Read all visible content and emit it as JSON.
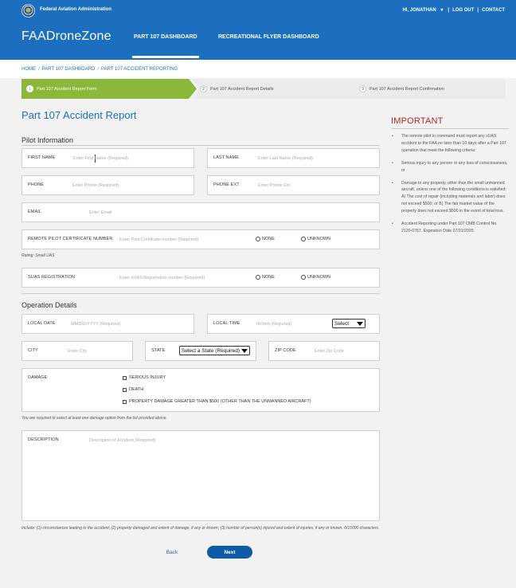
{
  "header": {
    "agency": "Federal Aviation Administration",
    "user_greeting": "HI, JONATHAN",
    "logout": "LOG OUT",
    "contact": "CONTACT",
    "brand": "FAADroneZone",
    "nav": [
      {
        "label": "PART 107 DASHBOARD",
        "active": true
      },
      {
        "label": "RECREATIONAL FLYER DASHBOARD",
        "active": false
      }
    ]
  },
  "breadcrumb": [
    "HOME",
    "PART 107 DASHBOARD",
    "PART 107 ACCIDENT REPORTING"
  ],
  "steps": [
    {
      "num": "1",
      "label": "Part 107 Accident Report Form",
      "active": true
    },
    {
      "num": "2",
      "label": "Part 107 Accident Report Details",
      "active": false
    },
    {
      "num": "3",
      "label": "Part 107 Accident Report Confirmation",
      "active": false
    }
  ],
  "form": {
    "title": "Part 107 Accident Report",
    "pilot_section": "Pilot Information",
    "first_name": {
      "label": "FIRST NAME",
      "placeholder": "Enter First Name (Required)",
      "value": ""
    },
    "last_name": {
      "label": "LAST NAME",
      "placeholder": "Enter Last Name (Required)",
      "value": ""
    },
    "phone": {
      "label": "PHONE",
      "placeholder": "Enter Phone (Required)",
      "value": ""
    },
    "phone_ext": {
      "label": "PHONE EXT",
      "placeholder": "Enter Phone Ext",
      "value": ""
    },
    "email": {
      "label": "EMAIL",
      "placeholder": "Enter Email",
      "value": ""
    },
    "cert": {
      "label": "REMOTE PILOT CERTIFICATE NUMBER",
      "placeholder": "Enter Pilot Certificate number (Required)",
      "value": "",
      "opt_none": "NONE",
      "opt_unknown": "UNKNOWN"
    },
    "rating": "Rating: Small UAS",
    "suas": {
      "label": "SUAS REGISTRATION",
      "placeholder": "Enter sUAS Registration number (Required)",
      "value": "",
      "opt_none": "NONE",
      "opt_unknown": "UNKNOWN"
    },
    "operation_section": "Operation Details",
    "local_date": {
      "label": "LOCAL DATE",
      "placeholder": "MM/DD/YYYY (Required)",
      "value": ""
    },
    "local_time": {
      "label": "LOCAL TIME",
      "placeholder": "hh:mm (Required)",
      "value": "",
      "select": "Select"
    },
    "city": {
      "label": "CITY",
      "placeholder": "Enter City",
      "value": ""
    },
    "state": {
      "label": "STATE",
      "select": "Select a State (Required)"
    },
    "zip": {
      "label": "ZIP CODE",
      "placeholder": "Enter Zip Code",
      "value": ""
    },
    "damage": {
      "label": "DAMAGE",
      "options": [
        "SERIOUS INJURY",
        "DEATH",
        "PROPERTY DAMAGE GREATER THAN $500 (OTHER THAN THE UNMANNED AIRCRAFT)"
      ]
    },
    "damage_note": "You are required to select at least one damage option from the list provided above.",
    "description": {
      "label": "DESCRIPTION",
      "placeholder": "Description of Accident (Required)",
      "value": ""
    },
    "description_note": "Include: (1) circumstances leading to the accident; (2) property damaged and extent of damage, if any or known; (3) number of person(s) injured and extent of injuries, if any or known. 0/15000 characters.",
    "back": "Back",
    "next": "Next"
  },
  "important": {
    "title": "IMPORTANT",
    "items": [
      "The remote pilot in command must report any sUAS accident to the FAA no later than 10 days after a Part 107 operation that meet the following criteria:",
      "Serious injury to any person or any loss of consciousness, or",
      "Damage to any property, other than the small unmanned aircraft, unless one of the following conditions is satisfied: A) The cost of repair (including materials and labor) does not exceed $500; or B) The fair market value of the property does not exceed $500 in the event of total loss.",
      "Accident Reporting under Part 107 OMB Control No. 2120-0767. Expiration Date 07/31/2020."
    ]
  },
  "colors": {
    "brand_blue": "#1c6fbe",
    "active_step": "#8bb73b",
    "important_red": "#b3262b",
    "next_button": "#0d5aa7"
  }
}
